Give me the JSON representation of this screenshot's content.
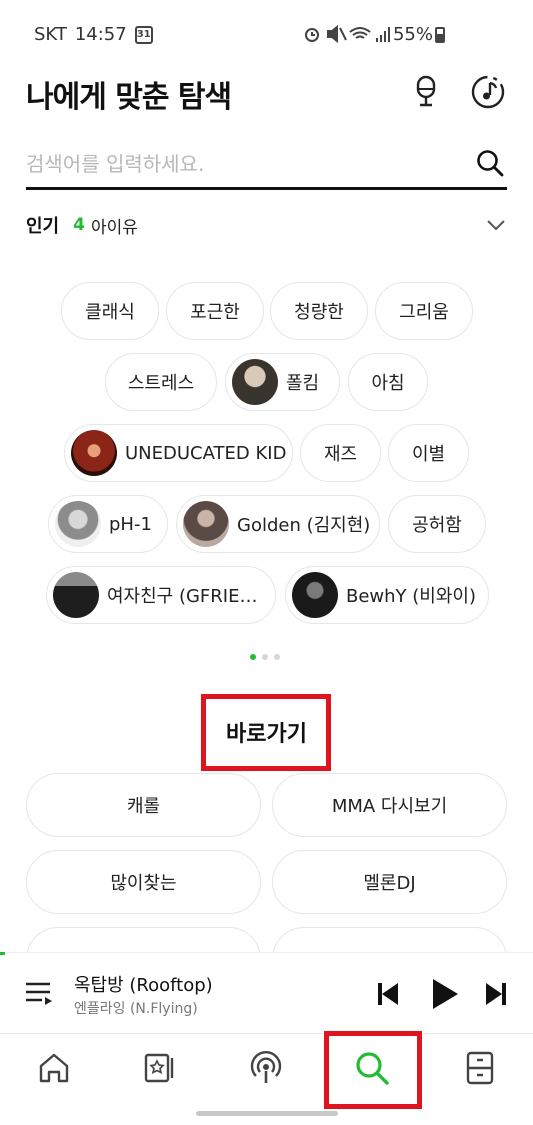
{
  "status_bar": {
    "carrier": "SKT",
    "time": "14:57",
    "calendar_day": "31",
    "battery": "55%"
  },
  "header": {
    "title": "나에게 맞춘 탐색",
    "mic_icon": "microphone-icon",
    "music_search_icon": "music-recognition-icon"
  },
  "search": {
    "placeholder": "검색어를 입력하세요.",
    "value": "",
    "icon": "search-icon"
  },
  "popular": {
    "label": "인기",
    "rank": "4",
    "term": "아이유"
  },
  "chips": [
    {
      "label": "클래식"
    },
    {
      "label": "포근한"
    },
    {
      "label": "청량한"
    },
    {
      "label": "그리움"
    },
    {
      "label": "스트레스"
    },
    {
      "label": "폴킴"
    },
    {
      "label": "아침"
    },
    {
      "label": "UNEDUCATED KID"
    },
    {
      "label": "재즈"
    },
    {
      "label": "이별"
    },
    {
      "label": "pH-1"
    },
    {
      "label": "Golden (김지현)"
    },
    {
      "label": "공허함"
    },
    {
      "label": "여자친구 (GFRIE…"
    },
    {
      "label": "BewhY (비와이)"
    }
  ],
  "pagination": {
    "current": 1,
    "total": 3
  },
  "shortcuts": {
    "title": "바로가기",
    "items": [
      {
        "label": "캐롤"
      },
      {
        "label": "MMA 다시보기"
      },
      {
        "label": "많이찾는"
      },
      {
        "label": "멜론DJ"
      }
    ]
  },
  "player": {
    "title": "옥탑방 (Rooftop)",
    "artist": "엔플라잉 (N.Flying)",
    "progress": 0.01
  },
  "nav": [
    {
      "icon": "home-icon"
    },
    {
      "icon": "music-card-icon"
    },
    {
      "icon": "podcast-icon"
    },
    {
      "icon": "search-icon",
      "active": true
    },
    {
      "icon": "library-icon"
    }
  ],
  "colors": {
    "accent": "#22bb33",
    "highlight_box": "#e0141e",
    "chip_border": "#e6e6e6"
  }
}
